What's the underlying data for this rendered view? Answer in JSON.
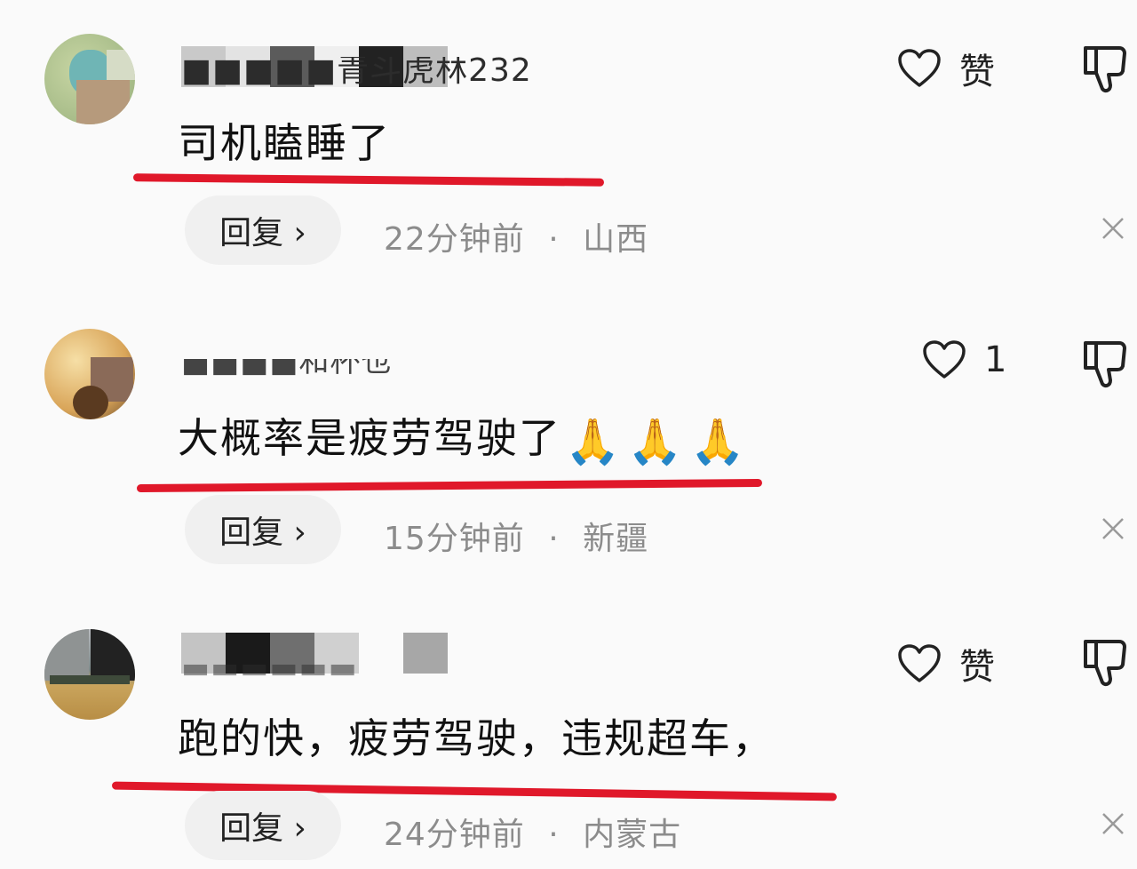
{
  "comments": [
    {
      "username": "■■■■■青斗虎林232",
      "text": "司机瞌睡了",
      "reply_label": "回复 ›",
      "time": "22分钟前",
      "location": "山西",
      "likes": "赞"
    },
    {
      "username": "■■■■和杯也",
      "text": "大概率是疲劳驾驶了",
      "emoji": "🙏🙏🙏",
      "reply_label": "回复 ›",
      "time": "15分钟前",
      "location": "新疆",
      "likes": "1"
    },
    {
      "username": "■■■■■■",
      "text": "跑的快，疲劳驾驶，违规超车，",
      "reply_label": "回复 ›",
      "time": "24分钟前",
      "location": "内蒙古",
      "likes": "赞"
    }
  ],
  "meta_separator": "·",
  "colors": {
    "underline": "#e0182a",
    "meta_text": "#8c8c8c",
    "reply_bg": "#f0f0f0"
  },
  "icons": {
    "like": "heart-outline-icon",
    "dislike": "thumbs-down-icon",
    "close": "close-x-icon"
  }
}
